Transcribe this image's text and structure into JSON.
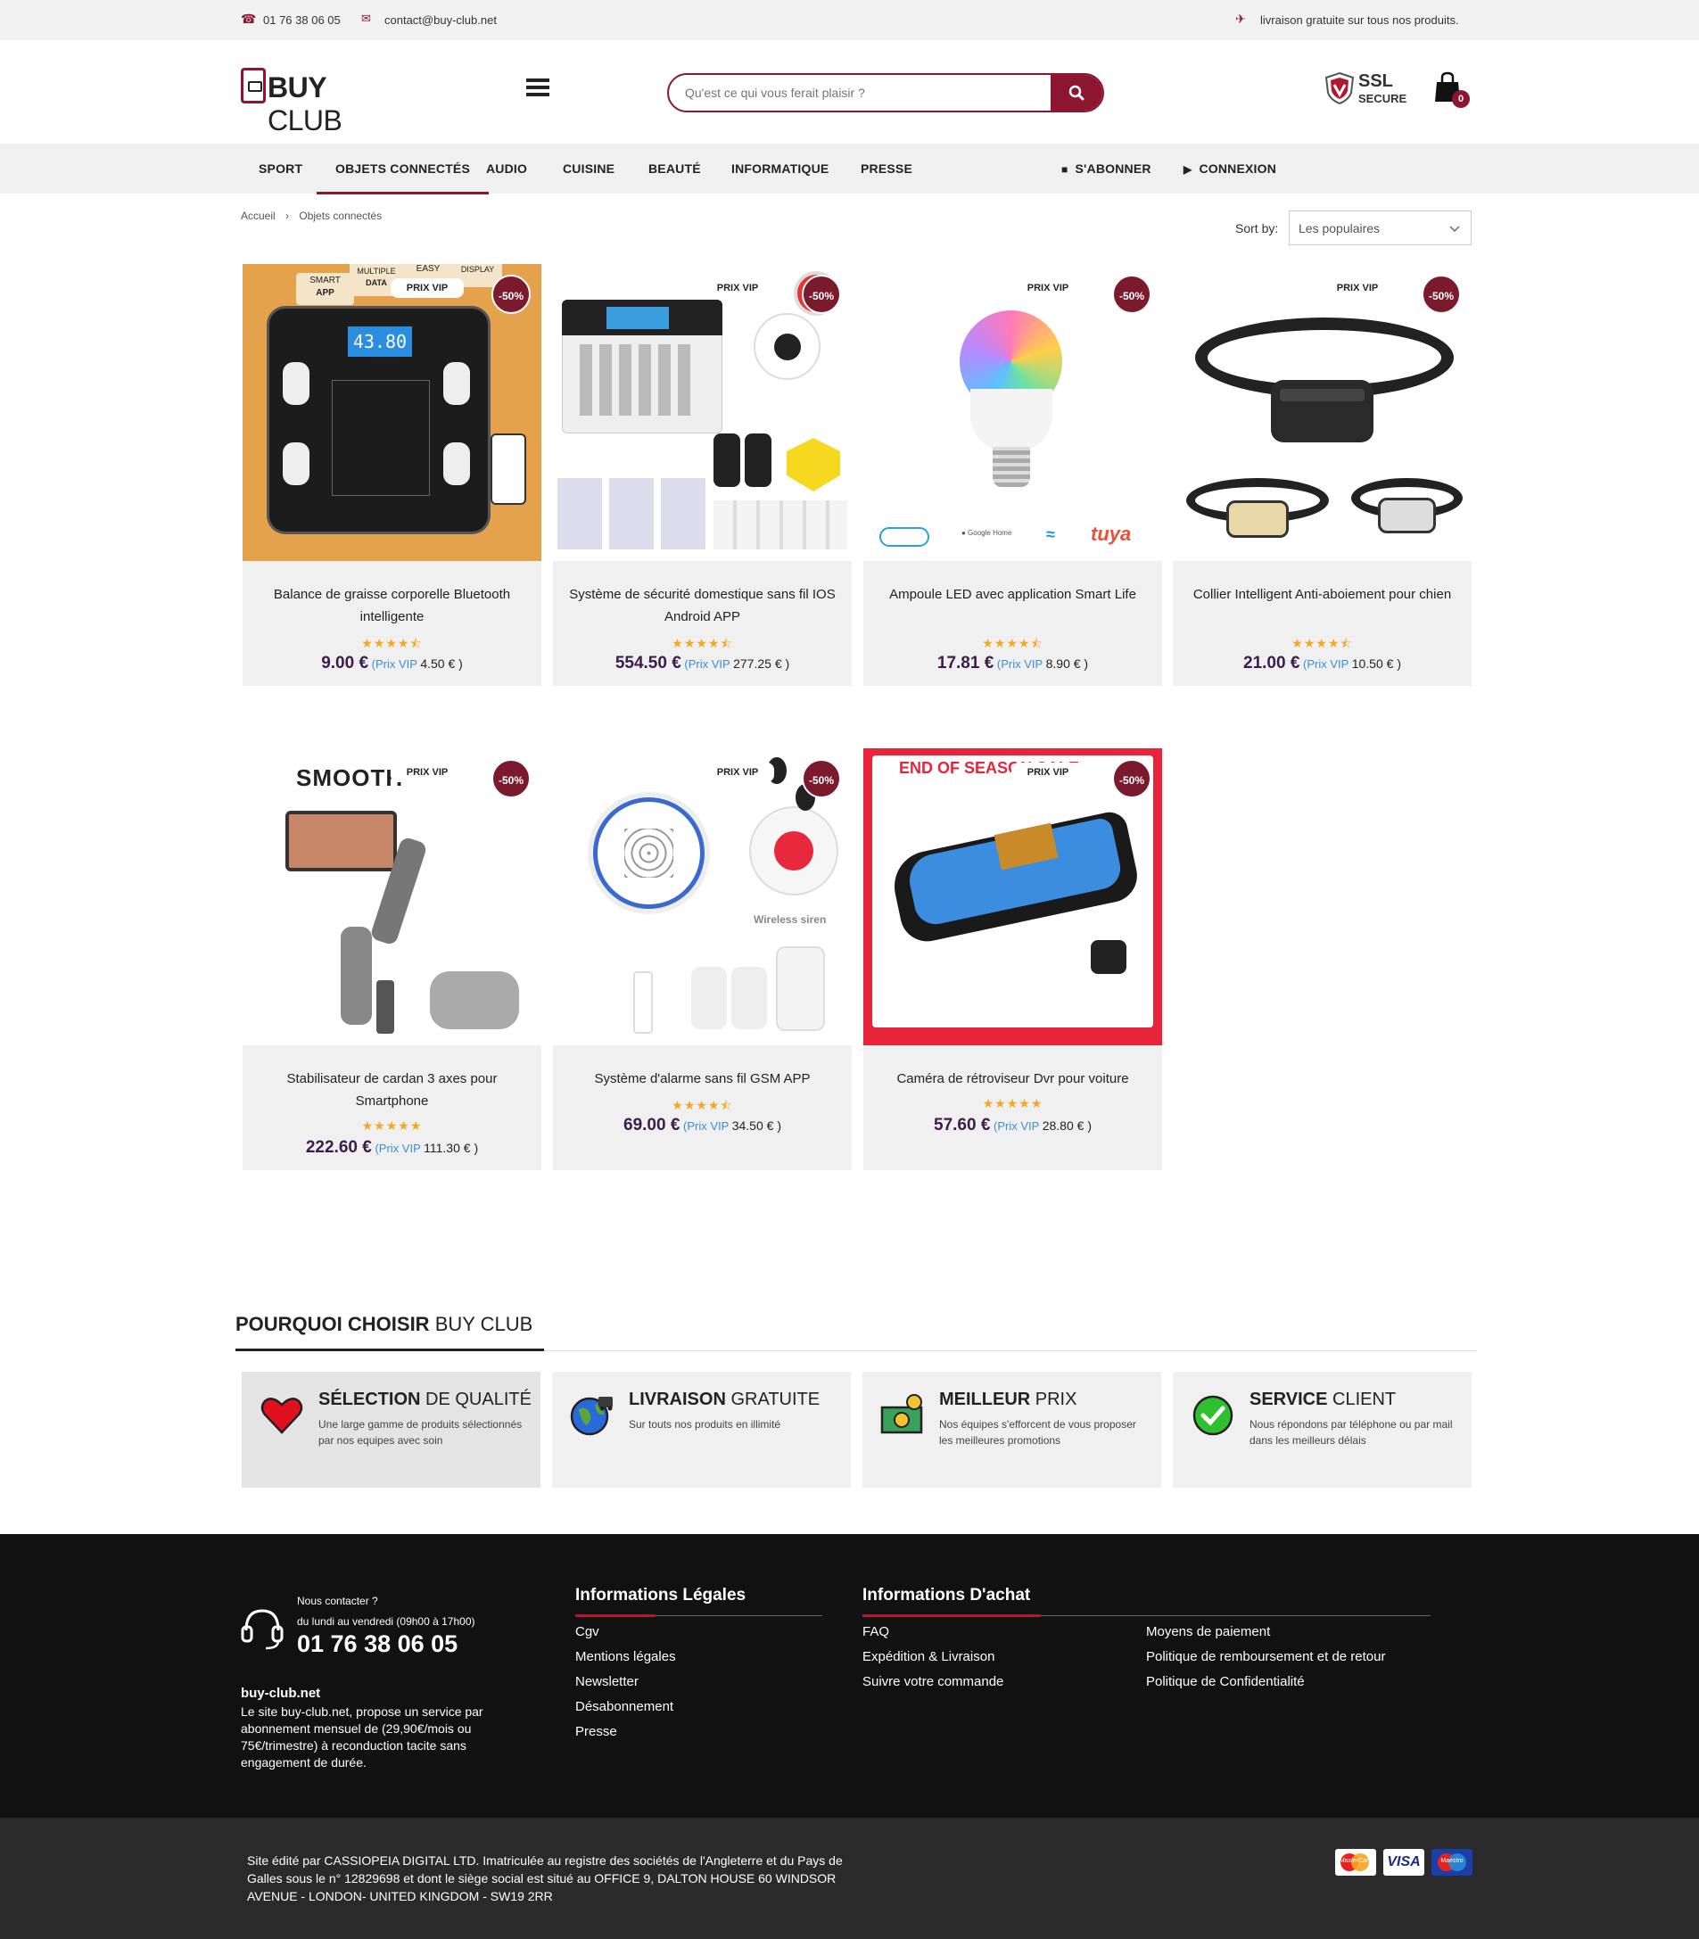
{
  "topbar": {
    "phone": "01 76 38 06 05",
    "email": "contact@buy-club.net",
    "shipping": "livraison gratuite sur tous nos produits."
  },
  "header": {
    "logo_bold": "BUY",
    "logo_light": " CLUB",
    "search_placeholder": "Qu'est ce qui vous ferait plaisir ?",
    "ssl_line1": "SSL",
    "ssl_line2": "SECURE",
    "cart_count": "0"
  },
  "nav": {
    "items": [
      "SPORT",
      "OBJETS CONNECTÉS",
      "AUDIO",
      "CUISINE",
      "BEAUTÉ",
      "INFORMATIQUE",
      "PRESSE"
    ],
    "subscribe": "S'ABONNER",
    "login": "CONNEXION"
  },
  "breadcrumb": {
    "home": "Accueil",
    "current": "Objets connectés"
  },
  "sort": {
    "label": "Sort by:",
    "value": "Les populaires"
  },
  "product_badges": {
    "vip": "PRIX VIP",
    "discount": "-50%"
  },
  "products": [
    {
      "name": "Balance de graisse corporelle Bluetooth intelligente",
      "price": "9.00 €",
      "vip_label": "(Prix VIP",
      "vip_price": "4.50 € )",
      "rating": 4.5
    },
    {
      "name": "Système de sécurité domestique sans fil IOS Android APP",
      "price": "554.50 €",
      "vip_label": "(Prix VIP",
      "vip_price": "277.25 € )",
      "rating": 4.5
    },
    {
      "name": "Ampoule LED avec application Smart Life",
      "price": "17.81 €",
      "vip_label": "(Prix VIP",
      "vip_price": "8.90 € )",
      "rating": 4.5
    },
    {
      "name": "Collier Intelligent Anti-aboiement pour chien",
      "price": "21.00 €",
      "vip_label": "(Prix VIP",
      "vip_price": "10.50 € )",
      "rating": 4.5
    },
    {
      "name": "Stabilisateur de cardan 3 axes pour Smartphone",
      "price": "222.60 €",
      "vip_label": "(Prix VIP",
      "vip_price": "111.30 € )",
      "rating": 5
    },
    {
      "name": "Système d'alarme sans fil GSM APP",
      "price": "69.00 €",
      "vip_label": "(Prix VIP",
      "vip_price": "34.50 € )",
      "rating": 4.5
    },
    {
      "name": "Caméra de rétroviseur Dvr pour voiture",
      "price": "57.60 €",
      "vip_label": "(Prix VIP",
      "vip_price": "28.80 € )",
      "rating": 5
    }
  ],
  "image_texts": {
    "p1_tags": [
      "SMART",
      "APP",
      "MULTIPLE",
      "DATA",
      "EASY",
      "DISPLAY"
    ],
    "p1_screen": "43.80",
    "p3_brand": "tuya",
    "p5_brand": "SMOOTH",
    "p6_siren": "Wireless siren",
    "p7_banner": "END OF SEASON SALE"
  },
  "why": {
    "title_bold": "POURQUOI CHOISIR",
    "title_light": " BUY CLUB",
    "features": [
      {
        "bold": "SÉLECTION",
        "light": " DE QUALITÉ",
        "desc": "Une large gamme de produits sélectionnés par nos equipes avec soin",
        "icon": "heart-icon"
      },
      {
        "bold": "LIVRAISON",
        "light": " GRATUITE",
        "desc": "Sur touts nos produits en illimité",
        "icon": "globe-delivery-icon"
      },
      {
        "bold": "MEILLEUR",
        "light": " PRIX",
        "desc": "Nos équipes s'efforcent de vous proposer les meilleures promotions",
        "icon": "money-icon"
      },
      {
        "bold": "SERVICE",
        "light": " CLIENT",
        "desc": "Nous répondons par téléphone ou par mail dans les meilleurs délais",
        "icon": "check-icon"
      }
    ]
  },
  "footer": {
    "contact_label": "Nous contacter ?",
    "hours": "du lundi au vendredi (09h00 à 17h00)",
    "phone": "01 76 38 06 05",
    "site_name": "buy-club.net",
    "site_desc": "Le site buy-club.net, propose un service par abonnement mensuel de (29,90€/mois ou 75€/trimestre) à reconduction tacite sans engagement de durée.",
    "legal_title": "Informations Légales",
    "legal_links": [
      "Cgv",
      "Mentions légales",
      "Newsletter",
      "Désabonnement",
      "Presse"
    ],
    "purchase_title": "Informations D'achat",
    "purchase_col1": [
      "FAQ",
      "Expédition & Livraison",
      "Suivre votre commande"
    ],
    "purchase_col2": [
      "Moyens de paiement",
      "Politique de remboursement et de retour",
      "Politique de Confidentialité"
    ]
  },
  "bottom": {
    "legal_text": "Site édité par CASSIOPEIA DIGITAL LTD. Imatriculée au registre des sociétés de l'Angleterre et du Pays de Galles sous le n° 12829698 et dont le siège social est situé au OFFICE 9, DALTON HOUSE 60 WINDSOR AVENUE - LONDON- UNITED KINGDOM - SW19 2RR",
    "payment_labels": [
      "MasterCard",
      "VISA",
      "Maestro"
    ]
  },
  "colors": {
    "brand": "#8c1530",
    "discount": "#7b1a2c",
    "price": "#3b1d4a",
    "vip": "#3a8fd0",
    "star": "#f5a623"
  }
}
